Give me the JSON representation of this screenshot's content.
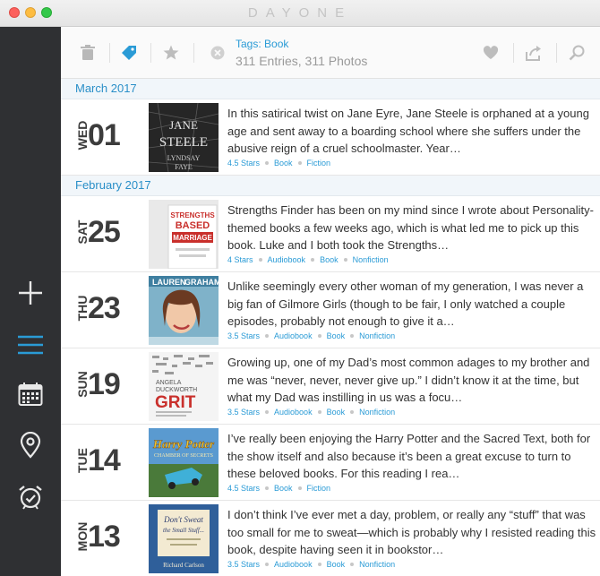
{
  "window": {
    "title": "DAYONE"
  },
  "toolbar": {
    "tag_filter": "Tags: Book",
    "counts": "311 Entries, 311 Photos"
  },
  "colors": {
    "accent": "#2a9bd6",
    "sidebar_bg": "#2f3033",
    "month_bg": "#f1f6fa"
  },
  "sidebar": {
    "items": [
      {
        "icon": "plus-icon"
      },
      {
        "icon": "list-icon",
        "active": true
      },
      {
        "icon": "calendar-icon"
      },
      {
        "icon": "map-pin-icon"
      },
      {
        "icon": "alarm-clock-icon"
      }
    ]
  },
  "sections": [
    {
      "month": "March 2017",
      "entries": [
        {
          "dow": "WED",
          "day": "01",
          "text": "In this satirical twist on Jane Eyre, Jane Steele is orphaned at a young age and sent away to a boarding school where she suffers under the abusive reign of a cruel schoolmaster. Year…",
          "tags": [
            "4.5 Stars",
            "Book",
            "Fiction"
          ],
          "cover": {
            "lines": [
              "JANE",
              "STEELE",
              "LYNDSAY",
              "FAYE"
            ]
          }
        }
      ]
    },
    {
      "month": "February 2017",
      "entries": [
        {
          "dow": "SAT",
          "day": "25",
          "text": "Strengths Finder has been on my mind since I wrote about Personality-themed books a few weeks ago, which is what led me to pick up this book. Luke and I both took the Strengths…",
          "tags": [
            "4 Stars",
            "Audiobook",
            "Book",
            "Nonfiction"
          ],
          "cover": {
            "lines": [
              "STRENGTHS",
              "BASED",
              "MARRIAGE"
            ]
          }
        },
        {
          "dow": "THU",
          "day": "23",
          "text": "Unlike seemingly every other woman of my generation, I was never a big fan of Gilmore Girls (though to be fair, I only watched a couple episodes, probably not enough to give it a…",
          "tags": [
            "3.5 Stars",
            "Audiobook",
            "Book",
            "Nonfiction"
          ],
          "cover": {
            "lines": [
              "LAUREN",
              "GRAHAM"
            ]
          }
        },
        {
          "dow": "SUN",
          "day": "19",
          "text": "Growing up, one of my Dad’s most common adages to my brother and me was “never, never, never give up.” I didn’t know it at the time, but what my Dad was instilling in us was a focu…",
          "tags": [
            "3.5 Stars",
            "Audiobook",
            "Book",
            "Nonfiction"
          ],
          "cover": {
            "lines": [
              "ANGELA",
              "DUCKWORTH",
              "GRIT"
            ]
          }
        },
        {
          "dow": "TUE",
          "day": "14",
          "text": "I’ve really been enjoying the Harry Potter and the Sacred Text, both for the show itself and also because it’s been a great excuse to turn to these beloved books. For this reading I rea…",
          "tags": [
            "4.5 Stars",
            "Book",
            "Fiction"
          ],
          "cover": {
            "lines": [
              "Harry Potter",
              "CHAMBER OF SECRETS"
            ]
          }
        },
        {
          "dow": "MON",
          "day": "13",
          "text": "I don’t think I’ve ever met a day, problem, or really any “stuff” that was too small for me to sweat—which is probably why I resisted reading this book, despite having seen it in bookstor…",
          "tags": [
            "3.5 Stars",
            "Audiobook",
            "Book",
            "Nonfiction"
          ],
          "cover": {
            "lines": [
              "Don't Sweat",
              "the Small Stuff...",
              "Richard Carlson"
            ]
          }
        }
      ]
    }
  ]
}
